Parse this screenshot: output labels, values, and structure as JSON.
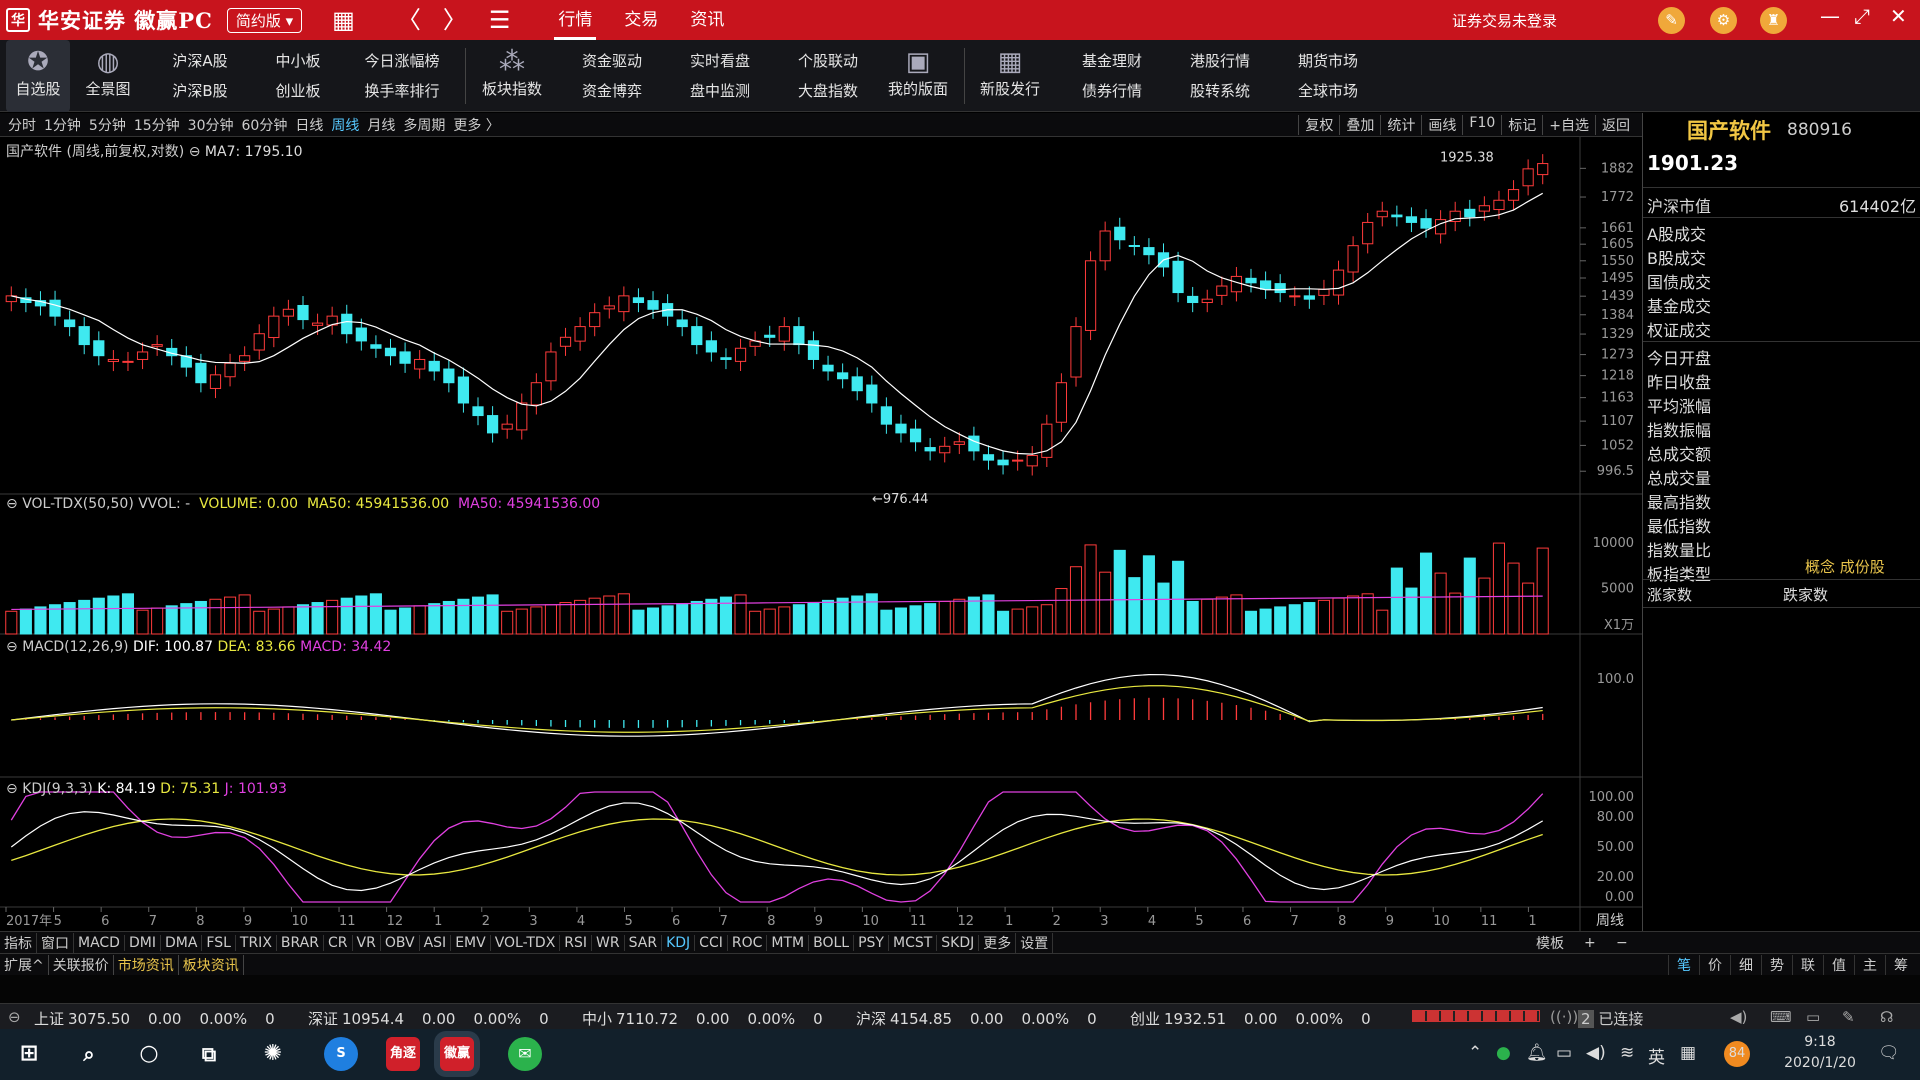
{
  "titlebar": {
    "logo": "华安证券 徽赢PC",
    "logo_mark": "华",
    "edition": "简约版",
    "menu": [
      "行情",
      "交易",
      "资讯"
    ],
    "login_status": "证券交易未登录"
  },
  "toolbar": {
    "favorites": "自选股",
    "overview": "全景图",
    "pairs": [
      [
        "沪深A股",
        "沪深B股"
      ],
      [
        "中小板",
        "创业板"
      ],
      [
        "今日涨幅榜",
        "换手率排行"
      ]
    ],
    "sector_index": "板块指数",
    "pairs2": [
      [
        "资金驱动",
        "资金博弈"
      ],
      [
        "实时看盘",
        "盘中监测"
      ],
      [
        "个股联动",
        "大盘指数"
      ]
    ],
    "my_layout": "我的版面",
    "ipo": "新股发行",
    "pairs3": [
      [
        "基金理财",
        "债券行情"
      ],
      [
        "港股行情",
        "股转系统"
      ],
      [
        "期货市场",
        "全球市场"
      ]
    ]
  },
  "periodbar": {
    "periods": [
      "分时",
      "1分钟",
      "5分钟",
      "15分钟",
      "30分钟",
      "60分钟",
      "日线",
      "周线",
      "月线",
      "多周期",
      "更多 〉"
    ],
    "active": "周线",
    "tools": [
      "复权",
      "叠加",
      "统计",
      "画线",
      "F10",
      "标记",
      "+自选",
      "返回"
    ]
  },
  "main_chart": {
    "label": "国产软件 (周线,前复权,对数)",
    "ma": "MA7: 1795.10",
    "high_label": "1925.38",
    "low_label": "←976.44",
    "yticks": [
      "1882",
      "1772",
      "1661",
      "1605",
      "1550",
      "1495",
      "1439",
      "1384",
      "1329",
      "1273",
      "1218",
      "1163",
      "1107",
      "1052",
      "996.5"
    ]
  },
  "vol_panel": {
    "label": "VOL-TDX(50,50) VVOL: -",
    "volume": "VOLUME: 0.00",
    "ma50a": "MA50: 45941536.00",
    "ma50b": "MA50: 45941536.00",
    "yticks": [
      "10000",
      "5000"
    ],
    "unit": "X1万"
  },
  "macd_panel": {
    "label": "MACD(12,26,9)",
    "dif": "DIF: 100.87",
    "dea": "DEA: 83.66",
    "macd": "MACD: 34.42",
    "ytick": "100.0"
  },
  "kdj_panel": {
    "label": "KDJ(9,3,3)",
    "k": "K: 84.19",
    "d": "D: 75.31",
    "j": "J: 101.93",
    "yticks": [
      "100.00",
      "80.00",
      "50.00",
      "20.00",
      "0.00"
    ]
  },
  "xaxis": {
    "labels": [
      "2017年",
      "5",
      "6",
      "7",
      "8",
      "9",
      "10",
      "11",
      "12",
      "1",
      "2",
      "3",
      "4",
      "5",
      "6",
      "7",
      "8",
      "9",
      "10",
      "11",
      "12",
      "1",
      "2",
      "3",
      "4",
      "5",
      "6",
      "7",
      "8",
      "9",
      "10",
      "11",
      "1"
    ],
    "period": "周线"
  },
  "indicator_tabs": [
    "指标",
    "窗口",
    "MACD",
    "DMI",
    "DMA",
    "FSL",
    "TRIX",
    "BRAR",
    "CR",
    "VR",
    "OBV",
    "ASI",
    "EMV",
    "VOL-TDX",
    "RSI",
    "WR",
    "SAR",
    "KDJ",
    "CCI",
    "ROC",
    "MTM",
    "BOLL",
    "PSY",
    "MCST",
    "SKDJ",
    "更多",
    "设置"
  ],
  "indicator_active": "KDJ",
  "template_btn": "模板",
  "sub_tabs": [
    "扩展^",
    "关联报价",
    "市场资讯",
    "板块资讯"
  ],
  "right_tabs": [
    "笔",
    "价",
    "细",
    "势",
    "联",
    "值",
    "主",
    "筹"
  ],
  "rpanel": {
    "name": "国产软件",
    "code": "880916",
    "price": "1901.23",
    "market_cap_label": "沪深市值",
    "market_cap": "614402亿",
    "rows": [
      "A股成交",
      "B股成交",
      "国债成交",
      "基金成交",
      "权证成交",
      "今日开盘",
      "昨日收盘",
      "平均涨幅",
      "指数振幅",
      "总成交额",
      "总成交量",
      "最高指数",
      "最低指数",
      "指数量比",
      "板指类型"
    ],
    "type_value": "概念 成份股",
    "up_count": "涨家数",
    "down_count": "跌家数"
  },
  "ticker": [
    {
      "name": "上证",
      "val": "3075.50",
      "chg": "0.00",
      "pct": "0.00%",
      "vol": "0"
    },
    {
      "name": "深证",
      "val": "10954.4",
      "chg": "0.00",
      "pct": "0.00%",
      "vol": "0"
    },
    {
      "name": "中小",
      "val": "7110.72",
      "chg": "0.00",
      "pct": "0.00%",
      "vol": "0"
    },
    {
      "name": "沪深",
      "val": "4154.85",
      "chg": "0.00",
      "pct": "0.00%",
      "vol": "0"
    },
    {
      "name": "创业",
      "val": "1932.51",
      "chg": "0.00",
      "pct": "0.00%",
      "vol": "0"
    }
  ],
  "connection": "已连接",
  "conn_num": "2",
  "taskbar": {
    "apps": [
      "角逐",
      "徽赢"
    ],
    "ime": "英",
    "badge": "84",
    "time": "9:18",
    "date": "2020/1/20"
  },
  "chart_data": {
    "type": "candlestick",
    "series_main": "weekly candles, log scale, range approx 976 to 1925",
    "closes": [
      1440,
      1420,
      1410,
      1380,
      1350,
      1300,
      1270,
      1260,
      1255,
      1280,
      1300,
      1270,
      1240,
      1200,
      1220,
      1250,
      1270,
      1330,
      1380,
      1400,
      1370,
      1360,
      1380,
      1330,
      1310,
      1290,
      1270,
      1250,
      1260,
      1230,
      1200,
      1150,
      1120,
      1080,
      1100,
      1150,
      1200,
      1280,
      1320,
      1350,
      1390,
      1410,
      1440,
      1420,
      1400,
      1380,
      1350,
      1300,
      1280,
      1260,
      1290,
      1310,
      1320,
      1350,
      1300,
      1260,
      1230,
      1210,
      1180,
      1150,
      1100,
      1080,
      1060,
      1040,
      1050,
      1060,
      1040,
      1020,
      1010,
      1020,
      1030,
      1100,
      1200,
      1350,
      1550,
      1650,
      1620,
      1600,
      1570,
      1530,
      1450,
      1420,
      1430,
      1470,
      1500,
      1480,
      1460,
      1450,
      1440,
      1430,
      1460,
      1520,
      1600,
      1680,
      1720,
      1700,
      1680,
      1660,
      1690,
      1720,
      1700,
      1740,
      1760,
      1800,
      1880,
      1901
    ]
  }
}
